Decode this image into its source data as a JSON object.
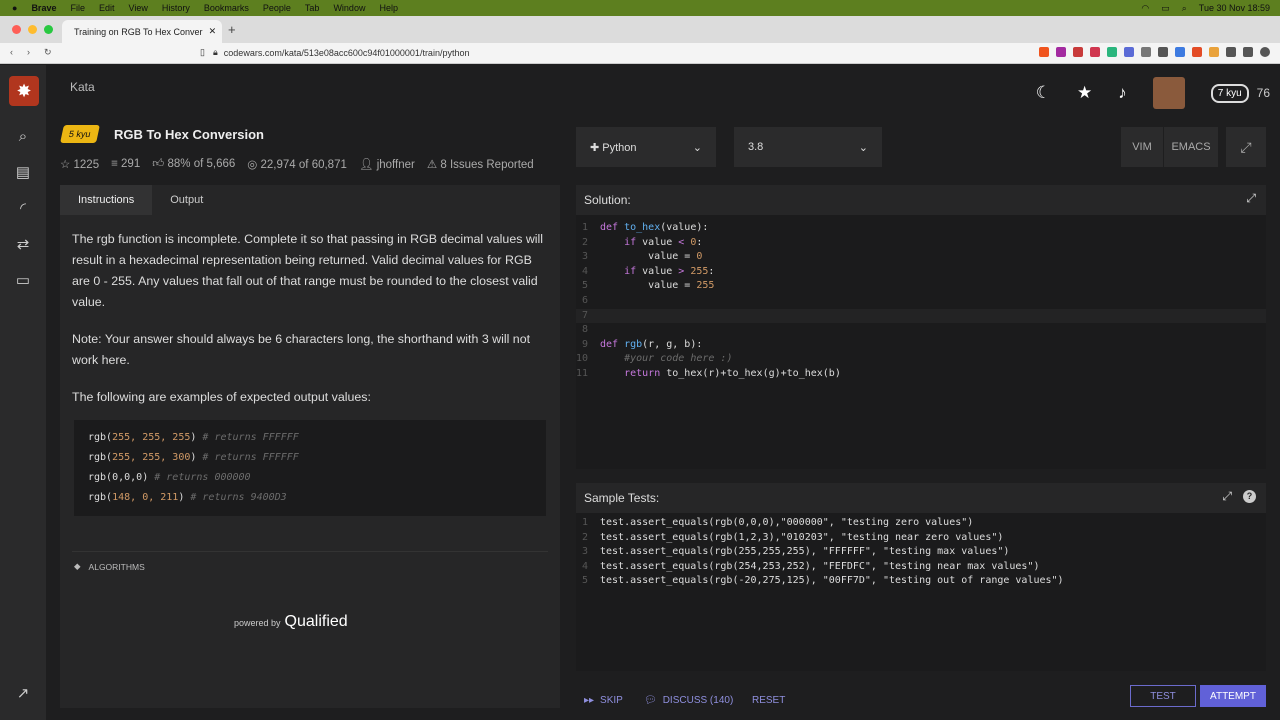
{
  "mac_menu": {
    "app": "Brave",
    "items": [
      "File",
      "Edit",
      "View",
      "History",
      "Bookmarks",
      "People",
      "Tab",
      "Window",
      "Help"
    ],
    "clock": "Tue 30 Nov  18:59"
  },
  "browser": {
    "tab_title": "Training on RGB To Hex Conver",
    "url": "codewars.com/kata/513e08acc600c94f01000001/train/python"
  },
  "topnav": {
    "kata_label": "Kata",
    "rank": "7 kyu",
    "honor": "76"
  },
  "kata": {
    "rank_badge": "5 kyu",
    "title": "RGB To Hex Conversion",
    "stars": "1225",
    "collections": "291",
    "satisfaction": "88%",
    "satisfaction_of": "of 5,666",
    "completed": "22,974",
    "completed_of": "of 60,871",
    "author": "jhoffner",
    "issues": "8 Issues Reported"
  },
  "tabs": {
    "instructions": "Instructions",
    "output": "Output"
  },
  "instructions": {
    "p1": "The rgb function is incomplete. Complete it so that passing in RGB decimal values will result in a hexadecimal representation being returned. Valid decimal values for RGB are 0 - 255. Any values that fall out of that range must be rounded to the closest valid value.",
    "p2": "Note: Your answer should always be 6 characters long, the shorthand with 3 will not work here.",
    "p3": "The following are examples of expected output values:",
    "examples": [
      {
        "call": "rgb(",
        "args": "255, 255, 255",
        "comment": "# returns FFFFFF"
      },
      {
        "call": "rgb(",
        "args": "255, 255, 300",
        "comment": "# returns FFFFFF"
      },
      {
        "call": "rgb(",
        "args": "0,0,0",
        "comment": "# returns 000000"
      },
      {
        "call": "rgb(",
        "args": "148, 0, 211",
        "comment": "# returns 9400D3"
      }
    ],
    "tag": "ALGORITHMS",
    "powered_by": "powered by",
    "qualified": "Qualified"
  },
  "editor": {
    "language": "Python",
    "version": "3.8",
    "vim": "VIM",
    "emacs": "EMACS",
    "solution_label": "Solution:",
    "tests_label": "Sample Tests:"
  },
  "solution_lines": [
    "def to_hex(value):",
    "    if value < 0:",
    "        value = 0",
    "    if value > 255:",
    "        value = 255",
    "",
    "",
    "",
    "def rgb(r, g, b):",
    "    #your code here :)",
    "    return to_hex(r)+to_hex(g)+to_hex(b)"
  ],
  "test_lines": [
    "test.assert_equals(rgb(0,0,0),\"000000\", \"testing zero values\")",
    "test.assert_equals(rgb(1,2,3),\"010203\", \"testing near zero values\")",
    "test.assert_equals(rgb(255,255,255), \"FFFFFF\", \"testing max values\")",
    "test.assert_equals(rgb(254,253,252), \"FEFDFC\", \"testing near max values\")",
    "test.assert_equals(rgb(-20,275,125), \"00FF7D\", \"testing out of range values\")"
  ],
  "bottom": {
    "skip": "SKIP",
    "discuss": "DISCUSS (140)",
    "reset": "RESET",
    "test": "TEST",
    "attempt": "ATTEMPT"
  }
}
